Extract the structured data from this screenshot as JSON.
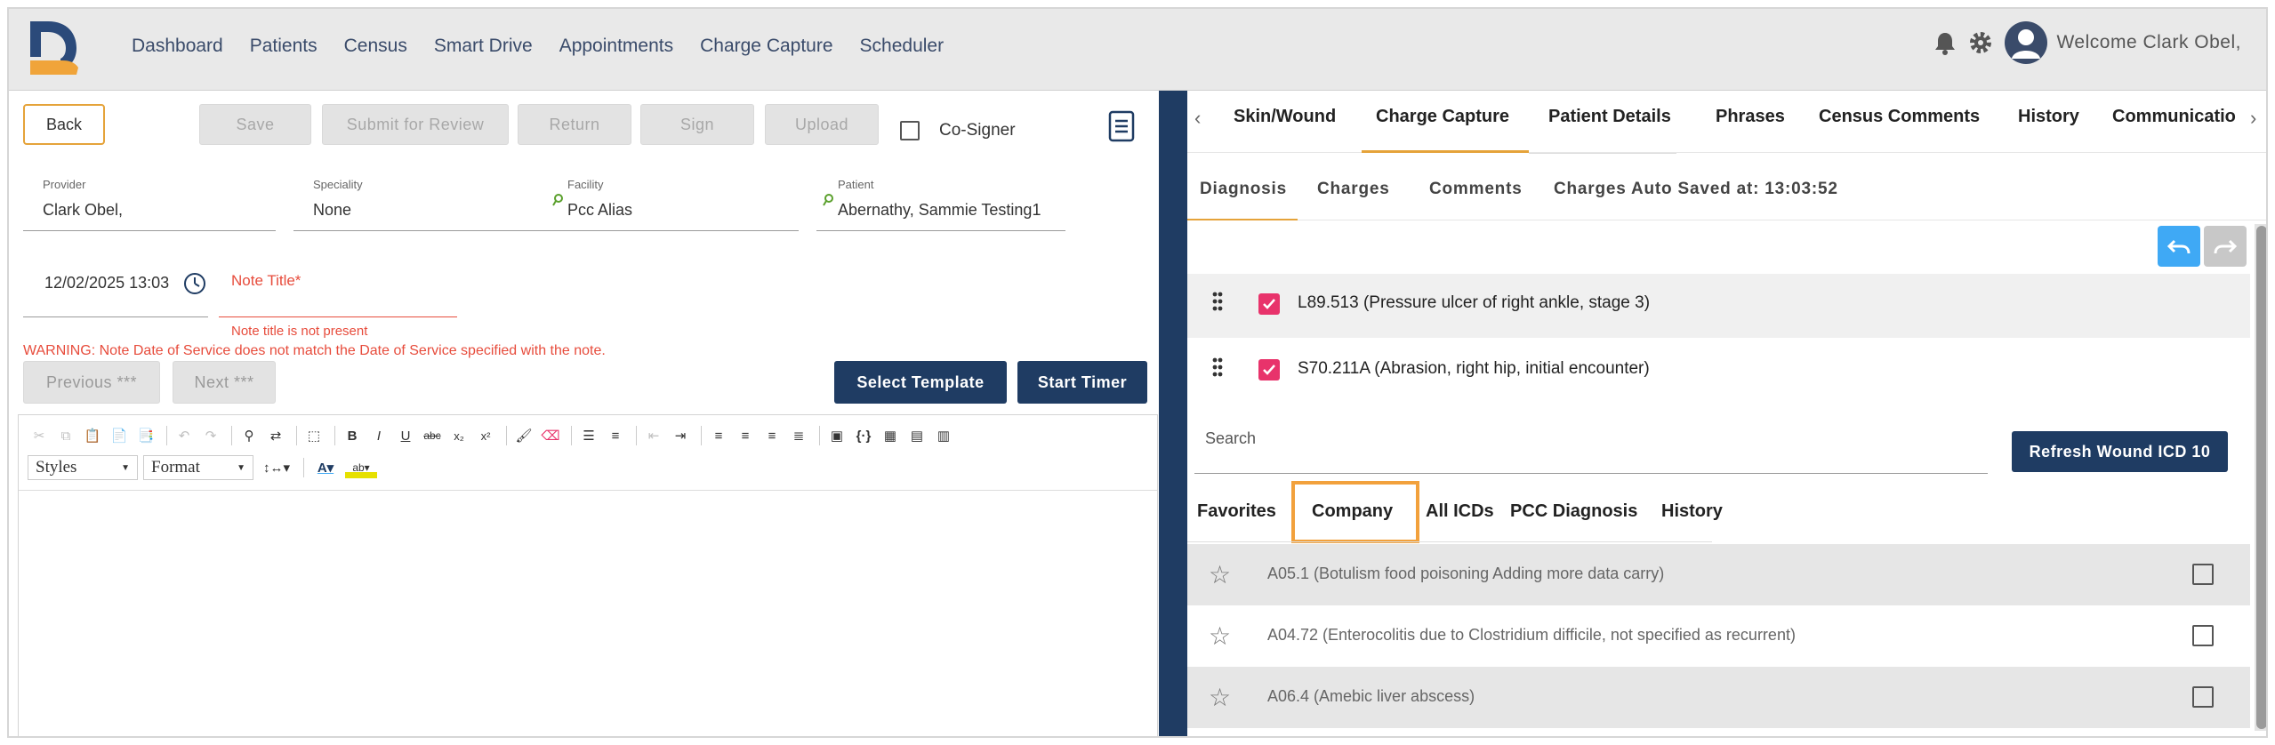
{
  "nav": {
    "items": [
      "Dashboard",
      "Patients",
      "Census",
      "Smart Drive",
      "Appointments",
      "Charge Capture",
      "Scheduler"
    ],
    "welcome": "Welcome Clark Obel,"
  },
  "left": {
    "buttons": {
      "back": "Back",
      "save": "Save",
      "submit": "Submit for Review",
      "return": "Return",
      "sign": "Sign",
      "upload": "Upload"
    },
    "cosigner": "Co-Signer",
    "fields": {
      "provider": {
        "label": "Provider",
        "value": "Clark Obel,"
      },
      "speciality": {
        "label": "Speciality",
        "value": "None"
      },
      "facility": {
        "label": "Facility",
        "value": "Pcc Alias"
      },
      "patient": {
        "label": "Patient",
        "value": "Abernathy, Sammie Testing1"
      }
    },
    "date": "12/02/2025 13:03",
    "note_title_label": "Note Title*",
    "note_title_error": "Note title is not present",
    "warning": "WARNING: Note Date of Service does not match the Date of Service specified with the note.",
    "previous": "Previous ***",
    "next": "Next ***",
    "select_template": "Select Template",
    "start_timer": "Start Timer",
    "editor": {
      "styles": "Styles",
      "format": "Format"
    }
  },
  "right": {
    "tabs": [
      "Skin/Wound",
      "Charge Capture",
      "Patient Details",
      "Phrases",
      "Census Comments",
      "History",
      "Communicatio"
    ],
    "active_tab": "Charge Capture",
    "subtabs": [
      "Diagnosis",
      "Charges",
      "Comments",
      "Charges Auto Saved at: 13:03:52"
    ],
    "diagnoses": [
      "L89.513 (Pressure ulcer of right ankle, stage 3)",
      "S70.211A (Abrasion, right hip, initial encounter)"
    ],
    "search_label": "Search",
    "refresh_button": "Refresh Wound ICD 10",
    "list_tabs": [
      "Favorites",
      "Company",
      "All ICDs",
      "PCC Diagnosis",
      "History"
    ],
    "icd_rows": [
      "A05.1 (Botulism food poisoning Adding more data carry)",
      "A04.72 (Enterocolitis due to Clostridium difficile, not specified as recurrent)",
      "A06.4 (Amebic liver abscess)"
    ]
  },
  "colors": {
    "navy": "#1f3c63",
    "accent": "#e5a33a",
    "error": "#e74c3c",
    "check": "#e8336b",
    "undo": "#3fa9f5"
  }
}
